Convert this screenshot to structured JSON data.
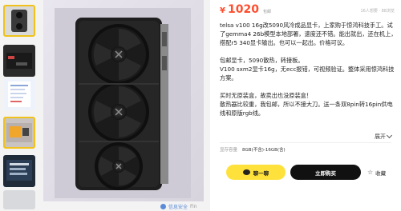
{
  "listing": {
    "price_currency": "¥",
    "price": "1020",
    "price_tag": "包邮",
    "meta": "16人想要 · 88浏览",
    "description": [
      "telsa v100 16g改5090风冷成品显卡，上家购于惊鸿科技手工。试了gemma4 26b模型本地部署，速度还不错。能出就出，还在机上，搭配r5 340显卡输出。也可以一起出。价格可议。",
      "包邮显卡，5090散热，转接板。",
      "V100 sxm2显卡16g，无ecc报错，可视频验证。整体采用惊鸿科技方案。",
      "买时无原装盒，故卖出也没原装盒！",
      "散热器比较重，我包邮，所以不接大刀。送一条双8pin转16pin供电线和原版rgb线。"
    ],
    "expand_label": "展开",
    "spec_label": "显存容量",
    "spec_value": "8GB(不含)-16GB(含)",
    "chat_label": "聊一聊",
    "buy_label": "立即购买",
    "fav_label": "收藏",
    "credit_label": "信息安全",
    "credit_extra": "Fin"
  },
  "icons": {
    "chat": "chat-bubble-icon",
    "fav": "star-icon",
    "expand": "chevron-down-icon"
  },
  "colors": {
    "price": "#ff4d2d",
    "chat_button": "#ffe13c",
    "buy_button": "#111111",
    "thumb_selected_border": "#f0c21b"
  }
}
